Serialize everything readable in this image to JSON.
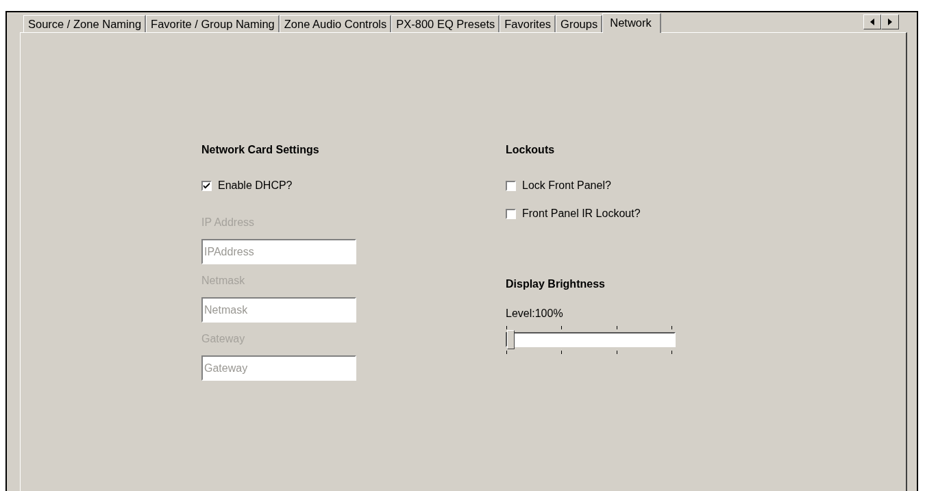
{
  "tabs": [
    {
      "label": "Source / Zone Naming",
      "selected": false
    },
    {
      "label": "Favorite / Group Naming",
      "selected": false
    },
    {
      "label": "Zone Audio Controls",
      "selected": false
    },
    {
      "label": "PX-800 EQ Presets",
      "selected": false
    },
    {
      "label": "Favorites",
      "selected": false
    },
    {
      "label": "Groups",
      "selected": false
    },
    {
      "label": "Network",
      "selected": true
    }
  ],
  "network_card_settings": {
    "heading": "Network Card Settings",
    "enable_dhcp": {
      "label": "Enable DHCP?",
      "checked": true
    },
    "fields": [
      {
        "label": "IP Address",
        "value": "IPAddress",
        "disabled": true
      },
      {
        "label": "Netmask",
        "value": "Netmask",
        "disabled": true
      },
      {
        "label": "Gateway",
        "value": "Gateway",
        "disabled": true
      }
    ]
  },
  "lockouts": {
    "heading": "Lockouts",
    "options": [
      {
        "label": "Lock Front Panel?",
        "checked": false
      },
      {
        "label": "Front Panel IR Lockout?",
        "checked": false
      }
    ]
  },
  "display_brightness": {
    "heading": "Display Brightness",
    "reading": "Level:100%",
    "level": 0
  }
}
